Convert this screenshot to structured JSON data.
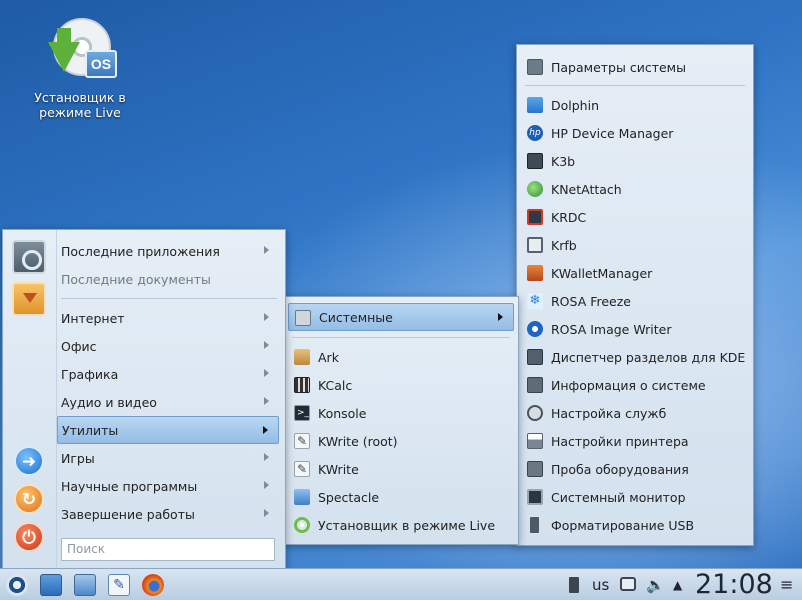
{
  "desktop": {
    "icon_label_line1": "Установщик в",
    "icon_label_line2": "режиме Live",
    "icon_badge": "OS"
  },
  "main_menu": {
    "items": [
      {
        "label": "Последние приложения",
        "has_submenu": true,
        "state": "normal"
      },
      {
        "label": "Последние документы",
        "has_submenu": false,
        "state": "disabled"
      },
      {
        "label": "Интернет",
        "has_submenu": true,
        "state": "normal"
      },
      {
        "label": "Офис",
        "has_submenu": true,
        "state": "normal"
      },
      {
        "label": "Графика",
        "has_submenu": true,
        "state": "normal"
      },
      {
        "label": "Аудио и видео",
        "has_submenu": true,
        "state": "normal"
      },
      {
        "label": "Утилиты",
        "has_submenu": true,
        "state": "selected"
      },
      {
        "label": "Игры",
        "has_submenu": true,
        "state": "normal"
      },
      {
        "label": "Научные программы",
        "has_submenu": true,
        "state": "normal"
      },
      {
        "label": "Завершение работы",
        "has_submenu": true,
        "state": "normal"
      }
    ],
    "search_placeholder": "Поиск",
    "side_icons": [
      "system-settings-icon",
      "package-installer-icon",
      "logout-icon",
      "restart-icon",
      "shutdown-icon"
    ]
  },
  "utilities_menu": {
    "items": [
      {
        "label": "Системные",
        "icon": "tools-icon",
        "state": "selected",
        "has_submenu": true
      },
      {
        "label": "Ark",
        "icon": "archive-icon",
        "state": "normal"
      },
      {
        "label": "KCalc",
        "icon": "calculator-icon",
        "state": "normal"
      },
      {
        "label": "Konsole",
        "icon": "terminal-icon",
        "state": "normal"
      },
      {
        "label": "KWrite (root)",
        "icon": "pen-icon",
        "state": "normal"
      },
      {
        "label": "KWrite",
        "icon": "pen-icon",
        "state": "normal"
      },
      {
        "label": "Spectacle",
        "icon": "camera-icon",
        "state": "normal"
      },
      {
        "label": "Установщик в режиме Live",
        "icon": "live-installer-icon",
        "state": "normal"
      }
    ]
  },
  "system_menu": {
    "items": [
      {
        "label": "Параметры системы",
        "icon": "settings-icon"
      },
      {
        "label": "Dolphin",
        "icon": "folder-icon"
      },
      {
        "label": "HP Device Manager",
        "icon": "hp-icon"
      },
      {
        "label": "K3b",
        "icon": "disc-burner-icon"
      },
      {
        "label": "KNetAttach",
        "icon": "globe-icon"
      },
      {
        "label": "KRDC",
        "icon": "remote-desktop-icon"
      },
      {
        "label": "Krfb",
        "icon": "desktop-sharing-icon"
      },
      {
        "label": "KWalletManager",
        "icon": "wallet-icon"
      },
      {
        "label": "ROSA Freeze",
        "icon": "snowflake-icon"
      },
      {
        "label": "ROSA Image Writer",
        "icon": "image-writer-icon"
      },
      {
        "label": "Диспетчер разделов для KDE",
        "icon": "partition-icon"
      },
      {
        "label": "Информация о системе",
        "icon": "info-icon"
      },
      {
        "label": "Настройка служб",
        "icon": "services-icon"
      },
      {
        "label": "Настройки принтера",
        "icon": "printer-icon"
      },
      {
        "label": "Проба оборудования",
        "icon": "hardware-icon"
      },
      {
        "label": "Системный монитор",
        "icon": "monitor-icon"
      },
      {
        "label": "Форматирование USB",
        "icon": "usb-icon"
      }
    ]
  },
  "taskbar": {
    "keyboard_layout": "us",
    "clock": "21:08",
    "launchers": [
      "rosa-launcher-icon",
      "desktop-icon",
      "file-manager-icon",
      "text-editor-icon",
      "firefox-icon"
    ],
    "tray": [
      "usb-tray-icon",
      "network-icon",
      "volume-icon",
      "tray-expand-icon",
      "menu-icon"
    ]
  }
}
